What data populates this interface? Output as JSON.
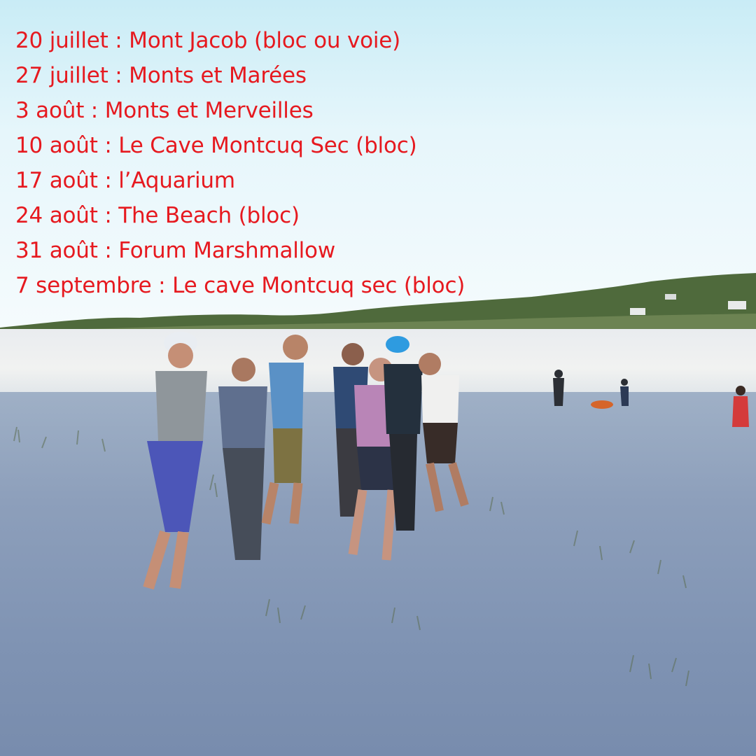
{
  "schedule": {
    "items": [
      "20 juillet : Mont Jacob (bloc ou voie)",
      "27 juillet : Monts et Marées",
      "3 août : Monts et Merveilles",
      "10 août : Le Cave Montcuq Sec (bloc)",
      "17 août : l’Aquarium",
      "24 août : The Beach (bloc)",
      "31 août : Forum Marshmallow",
      "7 septembre : Le cave Montcuq sec (bloc)"
    ]
  },
  "colors": {
    "text": "#e6191f",
    "sky": "#e6f6fb",
    "sand": "#8d9fbb",
    "forest": "#4f6a3c"
  }
}
